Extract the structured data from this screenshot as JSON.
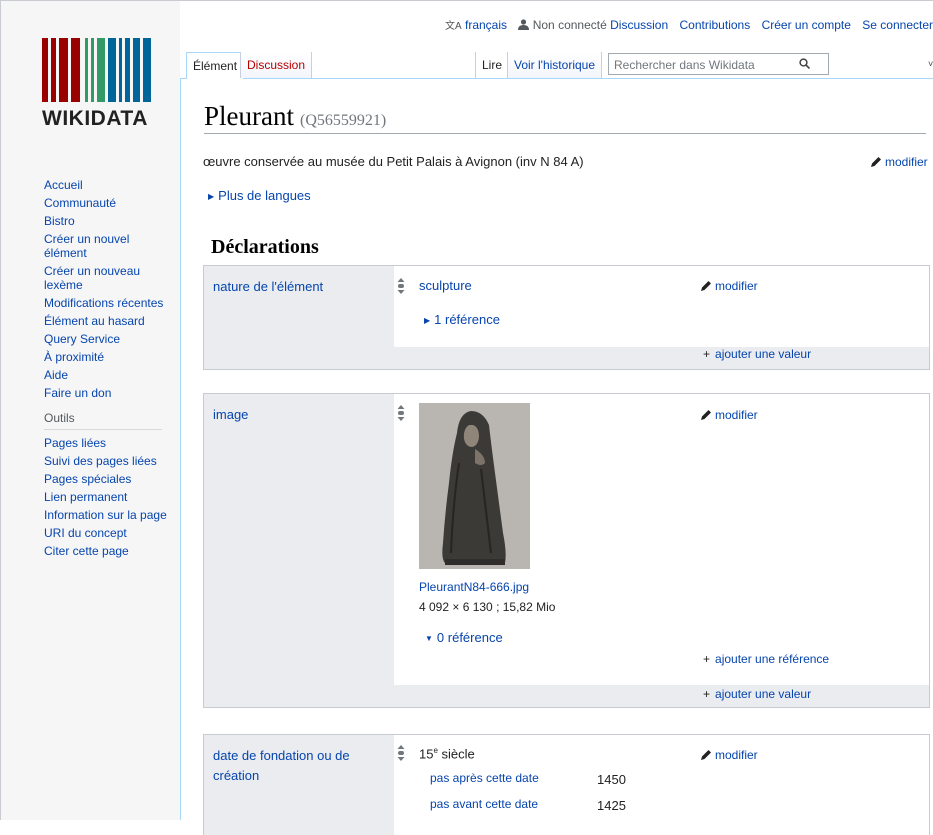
{
  "top_links": {
    "language": "français",
    "user": "Non connecté",
    "discussion": "Discussion",
    "contributions": "Contributions",
    "create_account": "Créer un compte",
    "login": "Se connecter"
  },
  "logo": {
    "wordmark": "WIKIDATA",
    "colors": [
      "#990000",
      "#339966",
      "#006699"
    ]
  },
  "tabs": {
    "item": "Élément",
    "discussion": "Discussion",
    "read": "Lire",
    "history": "Voir l'historique"
  },
  "search": {
    "placeholder": "Rechercher dans Wikidata"
  },
  "sidebar": {
    "nav": [
      "Accueil",
      "Communauté",
      "Bistro",
      "Créer un nouvel élément",
      "Créer un nouveau lexème",
      "Modifications récentes",
      "Élément au hasard",
      "Query Service",
      "À proximité",
      "Aide",
      "Faire un don"
    ],
    "tools_heading": "Outils",
    "tools": [
      "Pages liées",
      "Suivi des pages liées",
      "Pages spéciales",
      "Lien permanent",
      "Information sur la page",
      "URI du concept",
      "Citer cette page"
    ]
  },
  "page": {
    "title": "Pleurant",
    "qid": "(Q56559921)",
    "description": "œuvre conservée au musée du Petit Palais à Avignon (inv N 84 A)",
    "edit": "modifier",
    "more_languages": "Plus de langues",
    "statements_heading": "Déclarations"
  },
  "statements": {
    "nature": {
      "property": "nature de l'élément",
      "value": "sculpture",
      "references": "1 référence",
      "edit": "modifier",
      "add_value": "ajouter une valeur"
    },
    "image": {
      "property": "image",
      "filename": "PleurantN84-666.jpg",
      "fileinfo": "4 092 × 6 130 ; 15,82 Mio",
      "references": "0 référence",
      "edit": "modifier",
      "add_reference": "ajouter une référence",
      "add_value": "ajouter une valeur"
    },
    "founding": {
      "property": "date de fondation ou de création",
      "value_num": "15",
      "value_sup": "e",
      "value_rest": " siècle",
      "edit": "modifier",
      "qualifiers": [
        {
          "label": "pas après cette date",
          "value": "1450"
        },
        {
          "label": "pas avant cette date",
          "value": "1425"
        }
      ]
    }
  },
  "ui": {
    "plus": "+"
  }
}
